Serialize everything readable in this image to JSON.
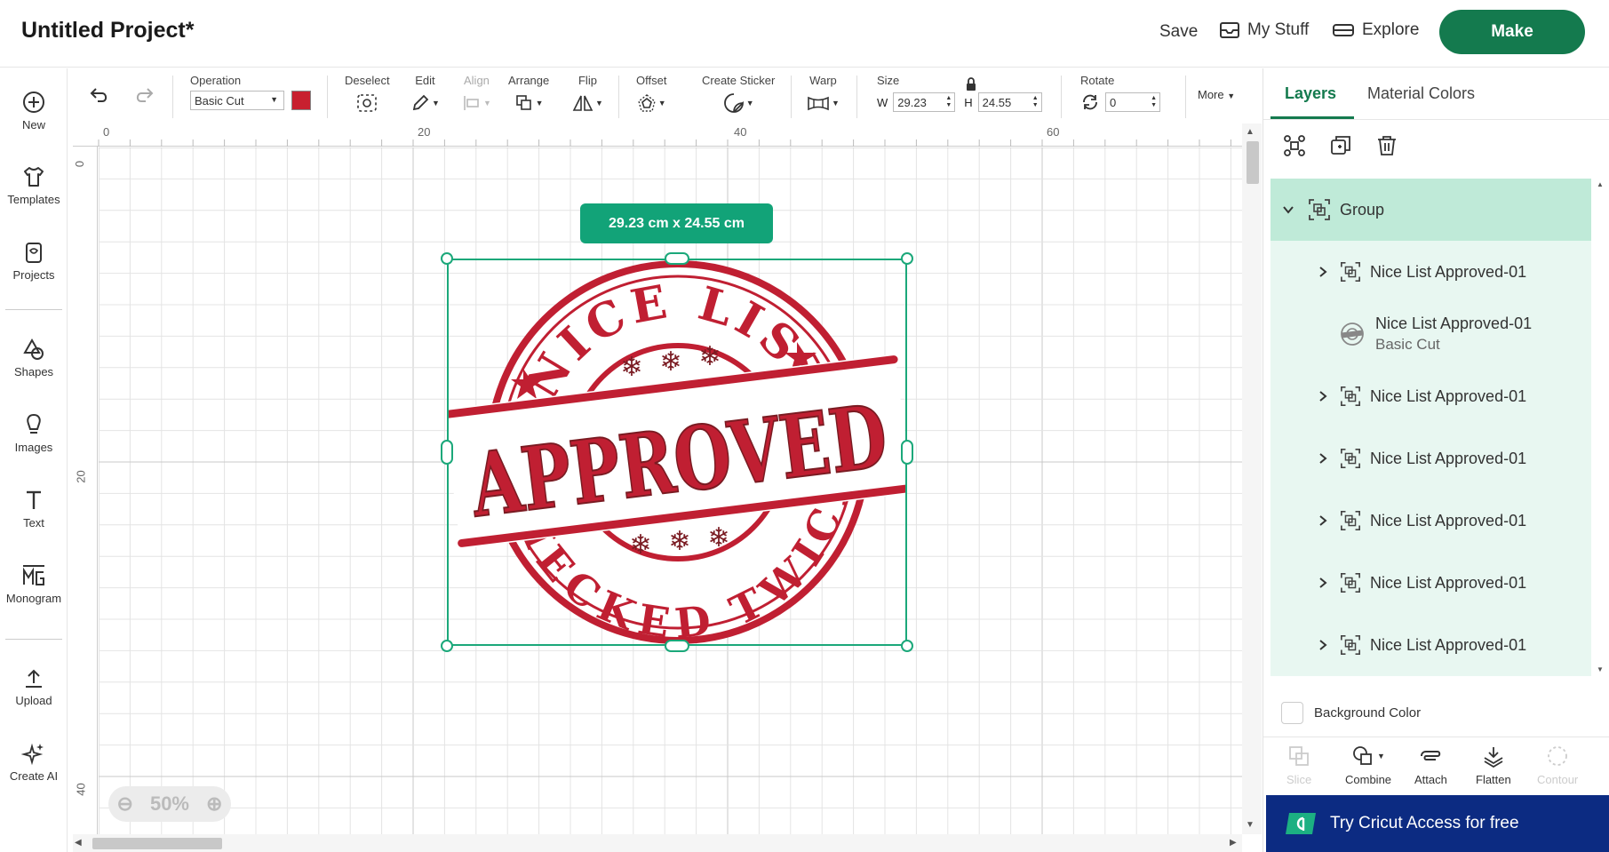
{
  "header": {
    "title": "Untitled Project*",
    "save": "Save",
    "my_stuff": "My Stuff",
    "explore": "Explore",
    "make": "Make"
  },
  "sidebar": {
    "items": [
      {
        "label": "New",
        "icon": "plus-circle-icon"
      },
      {
        "label": "Templates",
        "icon": "tshirt-icon"
      },
      {
        "label": "Projects",
        "icon": "projects-icon"
      },
      {
        "label": "Shapes",
        "icon": "shapes-icon"
      },
      {
        "label": "Images",
        "icon": "lightbulb-icon"
      },
      {
        "label": "Text",
        "icon": "text-icon"
      },
      {
        "label": "Monogram",
        "icon": "monogram-icon"
      },
      {
        "label": "Upload",
        "icon": "upload-icon"
      },
      {
        "label": "Create AI",
        "icon": "sparkle-icon"
      }
    ]
  },
  "toolbar": {
    "operation_label": "Operation",
    "operation_value": "Basic Cut",
    "operation_color": "#c8202f",
    "deselect": "Deselect",
    "edit": "Edit",
    "align": "Align",
    "arrange": "Arrange",
    "flip": "Flip",
    "offset": "Offset",
    "create_sticker": "Create Sticker",
    "warp": "Warp",
    "size": "Size",
    "width_label": "W",
    "width": "29.23",
    "height_label": "H",
    "height": "24.55",
    "rotate": "Rotate",
    "rotate_value": "0",
    "more": "More"
  },
  "canvas": {
    "ruler_top": [
      "0",
      "20",
      "40",
      "60"
    ],
    "ruler_left": [
      "0",
      "20",
      "40"
    ],
    "size_tooltip": "29.23  cm x 24.55  cm",
    "zoom": "50%",
    "stamp": {
      "top_text": "NICE LIST",
      "center_text": "APPROVED",
      "bottom_text": "CHECKED TWICE",
      "color": "#c01f32"
    }
  },
  "panel": {
    "tabs": [
      "Layers",
      "Material Colors"
    ],
    "group_label": "Group",
    "layers": [
      {
        "name": "Nice List Approved-01",
        "sub": "",
        "expandable": true
      },
      {
        "name": "Nice List Approved-01",
        "sub": "Basic Cut",
        "expandable": false
      },
      {
        "name": "Nice List Approved-01",
        "sub": "",
        "expandable": true
      },
      {
        "name": "Nice List Approved-01",
        "sub": "",
        "expandable": true
      },
      {
        "name": "Nice List Approved-01",
        "sub": "",
        "expandable": true
      },
      {
        "name": "Nice List Approved-01",
        "sub": "",
        "expandable": true
      },
      {
        "name": "Nice List Approved-01",
        "sub": "",
        "expandable": true
      }
    ],
    "background_color": "Background Color",
    "actions": [
      "Slice",
      "Combine",
      "Attach",
      "Flatten",
      "Contour"
    ],
    "try_access": "Try Cricut Access for free"
  }
}
